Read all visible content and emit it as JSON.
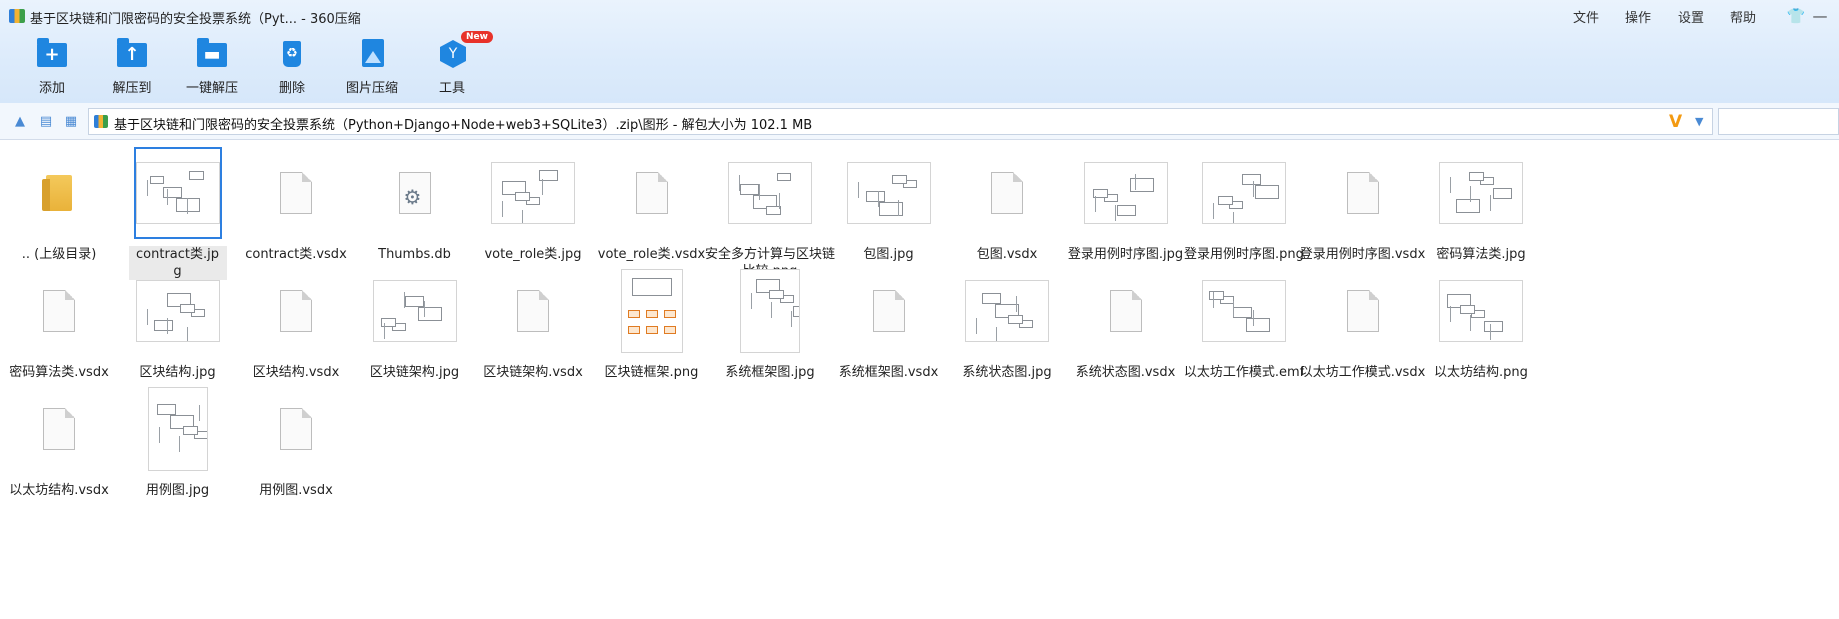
{
  "window": {
    "title": "基于区块链和门限密码的安全投票系统（Pyt... - 360压缩",
    "menu": [
      "文件",
      "操作",
      "设置",
      "帮助"
    ]
  },
  "toolbar": {
    "tools": [
      {
        "label": "添加",
        "icon": "add-icon"
      },
      {
        "label": "解压到",
        "icon": "extract-to-icon"
      },
      {
        "label": "一键解压",
        "icon": "one-click-extract-icon"
      },
      {
        "label": "删除",
        "icon": "delete-icon"
      },
      {
        "label": "图片压缩",
        "icon": "image-compress-icon"
      },
      {
        "label": "工具",
        "icon": "tools-icon",
        "badge": "New"
      }
    ]
  },
  "addressbar": {
    "path": "基于区块链和门限密码的安全投票系统（Python+Django+Node+web3+SQLite3）.zip\\图形 - 解包大小为 102.1 MB",
    "v_badge": "V"
  },
  "files": [
    {
      "name": ".. (上级目录)",
      "kind": "folder-up"
    },
    {
      "name": "contract类.jpg",
      "kind": "image",
      "selected": true
    },
    {
      "name": "contract类.vsdx",
      "kind": "doc"
    },
    {
      "name": "Thumbs.db",
      "kind": "gear"
    },
    {
      "name": "vote_role类.jpg",
      "kind": "image"
    },
    {
      "name": "vote_role类.vsdx",
      "kind": "doc"
    },
    {
      "name": "安全多方计算与区块链比较.png",
      "kind": "image"
    },
    {
      "name": "包图.jpg",
      "kind": "image"
    },
    {
      "name": "包图.vsdx",
      "kind": "doc"
    },
    {
      "name": "登录用例时序图.jpg",
      "kind": "image"
    },
    {
      "name": "登录用例时序图.png",
      "kind": "image"
    },
    {
      "name": "登录用例时序图.vsdx",
      "kind": "doc"
    },
    {
      "name": "密码算法类.jpg",
      "kind": "image"
    },
    {
      "name": "密码算法类.vsdx",
      "kind": "doc"
    },
    {
      "name": "区块结构.jpg",
      "kind": "image"
    },
    {
      "name": "区块结构.vsdx",
      "kind": "doc"
    },
    {
      "name": "区块链架构.jpg",
      "kind": "image"
    },
    {
      "name": "区块链架构.vsdx",
      "kind": "doc"
    },
    {
      "name": "区块链框架.png",
      "kind": "image-color"
    },
    {
      "name": "系统框架图.jpg",
      "kind": "image-tall"
    },
    {
      "name": "系统框架图.vsdx",
      "kind": "doc"
    },
    {
      "name": "系统状态图.jpg",
      "kind": "image"
    },
    {
      "name": "系统状态图.vsdx",
      "kind": "doc"
    },
    {
      "name": "以太坊工作模式.emf",
      "kind": "image"
    },
    {
      "name": "以太坊工作模式.vsdx",
      "kind": "doc"
    },
    {
      "name": "以太坊结构.png",
      "kind": "image"
    },
    {
      "name": "以太坊结构.vsdx",
      "kind": "doc"
    },
    {
      "name": "用例图.jpg",
      "kind": "image-tall"
    },
    {
      "name": "用例图.vsdx",
      "kind": "doc"
    }
  ]
}
